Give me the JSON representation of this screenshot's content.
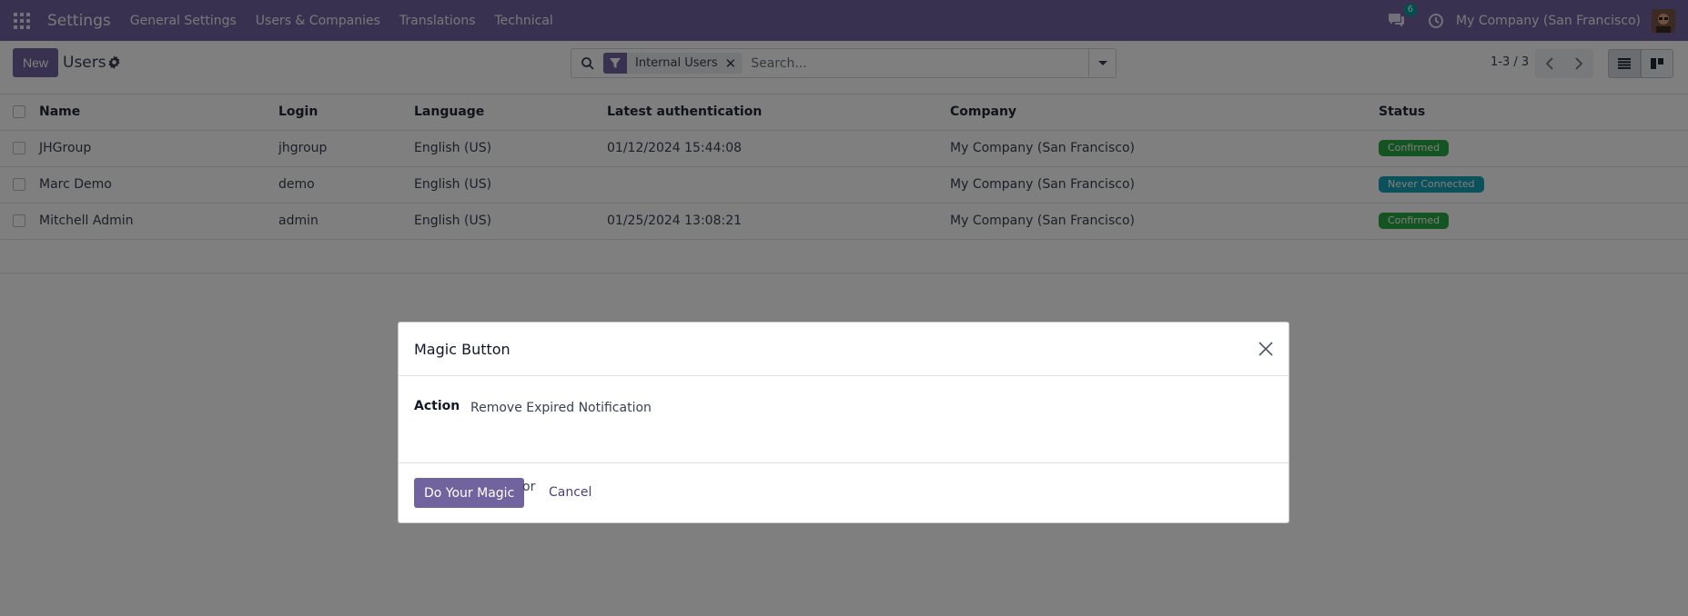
{
  "navbar": {
    "brand": "Settings",
    "menu": [
      "General Settings",
      "Users & Companies",
      "Translations",
      "Technical"
    ],
    "messages_count": "6",
    "company": "My Company (San Francisco)"
  },
  "control_panel": {
    "new_label": "New",
    "title": "Users",
    "search": {
      "facet": "Internal Users",
      "placeholder": "Search..."
    },
    "pager": "1-3 / 3"
  },
  "table": {
    "headers": [
      "Name",
      "Login",
      "Language",
      "Latest authentication",
      "Company",
      "Status"
    ],
    "rows": [
      {
        "name": "JHGroup",
        "login": "jhgroup",
        "language": "English (US)",
        "latest_auth": "01/12/2024 15:44:08",
        "company": "My Company (San Francisco)",
        "status": "Confirmed",
        "status_color": "#28a745"
      },
      {
        "name": "Marc Demo",
        "login": "demo",
        "language": "English (US)",
        "latest_auth": "",
        "company": "My Company (San Francisco)",
        "status": "Never Connected",
        "status_color": "#17a2b8"
      },
      {
        "name": "Mitchell Admin",
        "login": "admin",
        "language": "English (US)",
        "latest_auth": "01/25/2024 13:08:21",
        "company": "My Company (San Francisco)",
        "status": "Confirmed",
        "status_color": "#28a745"
      }
    ]
  },
  "modal": {
    "title": "Magic Button",
    "field_label": "Action",
    "field_value": "Remove Expired Notification",
    "primary_label": "Do Your Magic",
    "or_text": "or",
    "cancel_label": "Cancel"
  },
  "colors": {
    "brand": "#71639e",
    "confirmed": "#28a745",
    "never_connected": "#17a2b8"
  }
}
